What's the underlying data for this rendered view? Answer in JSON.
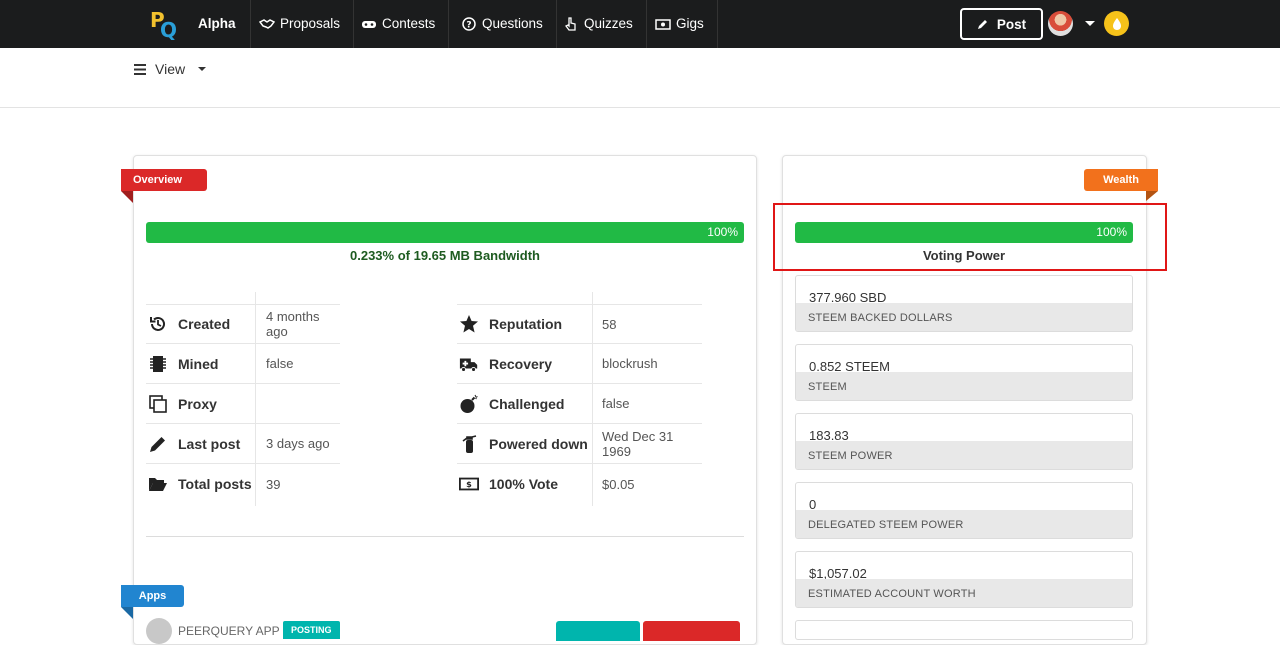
{
  "nav": {
    "brand": "Alpha",
    "items": [
      {
        "label": "Proposals",
        "icon": "handshake-icon"
      },
      {
        "label": "Contests",
        "icon": "gamepad-icon"
      },
      {
        "label": "Questions",
        "icon": "question-circle-icon"
      },
      {
        "label": "Quizzes",
        "icon": "hand-pointer-icon"
      },
      {
        "label": "Gigs",
        "icon": "money-bill-icon"
      }
    ],
    "post_label": "Post"
  },
  "subbar": {
    "view_label": "View"
  },
  "overview": {
    "ribbon": "Overview",
    "bandwidth_percent": "100%",
    "bandwidth_fill": 1.0,
    "bandwidth_label": "0.233% of 19.65 MB Bandwidth",
    "left_rows": [
      {
        "key": "Created",
        "value": "4 months ago",
        "icon": "history-icon"
      },
      {
        "key": "Mined",
        "value": "false",
        "icon": "microchip-icon"
      },
      {
        "key": "Proxy",
        "value": "",
        "icon": "copy-icon"
      },
      {
        "key": "Last post",
        "value": "3 days ago",
        "icon": "pencil-icon"
      },
      {
        "key": "Total posts",
        "value": "39",
        "icon": "folder-open-icon"
      }
    ],
    "right_rows": [
      {
        "key": "Reputation",
        "value": "58",
        "icon": "star-icon"
      },
      {
        "key": "Recovery",
        "value": "blockrush",
        "icon": "ambulance-icon"
      },
      {
        "key": "Challenged",
        "value": "false",
        "icon": "bomb-icon"
      },
      {
        "key": "Powered down",
        "value": "Wed Dec 31 1969",
        "icon": "fire-extinguisher-icon"
      },
      {
        "key": "100% Vote",
        "value": "$0.05",
        "icon": "money-bill-icon"
      }
    ]
  },
  "wealth": {
    "ribbon": "Wealth",
    "voting_percent": "100%",
    "voting_fill": 1.0,
    "voting_label": "Voting Power",
    "stats": [
      {
        "value": "377.960 SBD",
        "label": "STEEM BACKED DOLLARS"
      },
      {
        "value": "0.852 STEEM",
        "label": "STEEM"
      },
      {
        "value": "183.83",
        "label": "STEEM POWER"
      },
      {
        "value": "0",
        "label": "DELEGATED STEEM POWER"
      },
      {
        "value": "$1,057.02",
        "label": "ESTIMATED ACCOUNT WORTH"
      }
    ]
  },
  "apps": {
    "ribbon": "Apps",
    "app_name": "PEERQUERY APP",
    "badge": "POSTING"
  },
  "colors": {
    "nav_bg": "#1b1c1d",
    "progress_green": "#21ba45",
    "overview_red": "#db2828",
    "wealth_orange": "#f2711c",
    "apps_blue": "#2185d0",
    "highlight_red": "#e01616"
  }
}
